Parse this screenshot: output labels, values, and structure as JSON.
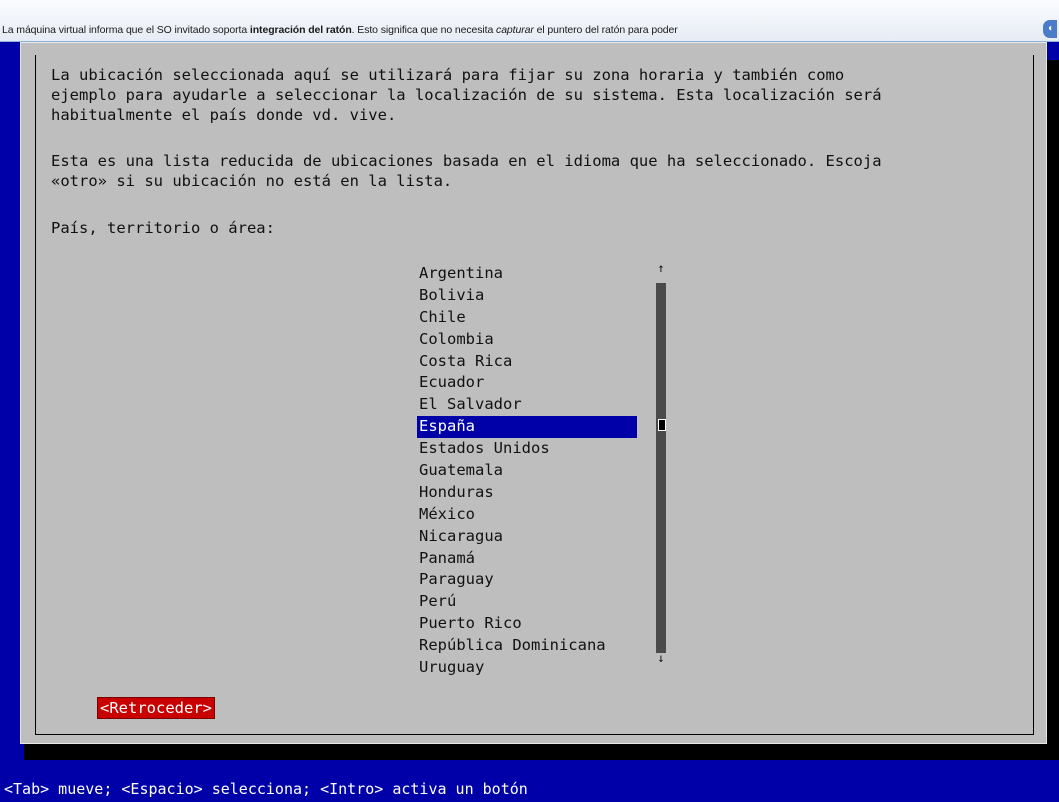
{
  "notification": {
    "text_before": "La máquina virtual informa que el SO invitado soporta ",
    "bold": "integración del ratón",
    "text_middle": ". Esto significa que no necesita ",
    "italic": "capturar",
    "text_after": " el puntero del ratón para poder",
    "close_glyph": "◖"
  },
  "dialog": {
    "paragraph1": "La ubicación seleccionada aquí se utilizará para fijar su zona horaria y también como\nejemplo para ayudarle a seleccionar la localización de su sistema. Esta localización será\nhabitualmente el país donde vd. vive.",
    "paragraph2": "Esta es una lista reducida de ubicaciones basada en el idioma que ha seleccionado. Escoja\n«otro» si su ubicación no está en la lista.",
    "prompt": "País, territorio o área:",
    "countries": [
      "Argentina",
      "Bolivia",
      "Chile",
      "Colombia",
      "Costa Rica",
      "Ecuador",
      "El Salvador",
      "España",
      "Estados Unidos",
      "Guatemala",
      "Honduras",
      "México",
      "Nicaragua",
      "Panamá",
      "Paraguay",
      "Perú",
      "Puerto Rico",
      "República Dominicana",
      "Uruguay"
    ],
    "selected_country": "España",
    "scroll_up": "↑",
    "scroll_down": "↓",
    "back_button": "<Retroceder>"
  },
  "statusbar": {
    "text": "<Tab> mueve; <Espacio> selecciona; <Intro> activa un botón"
  },
  "colors": {
    "background": "#0000a8",
    "dialog": "#bebebe",
    "selection": "#0000a8",
    "button": "#c80000"
  }
}
